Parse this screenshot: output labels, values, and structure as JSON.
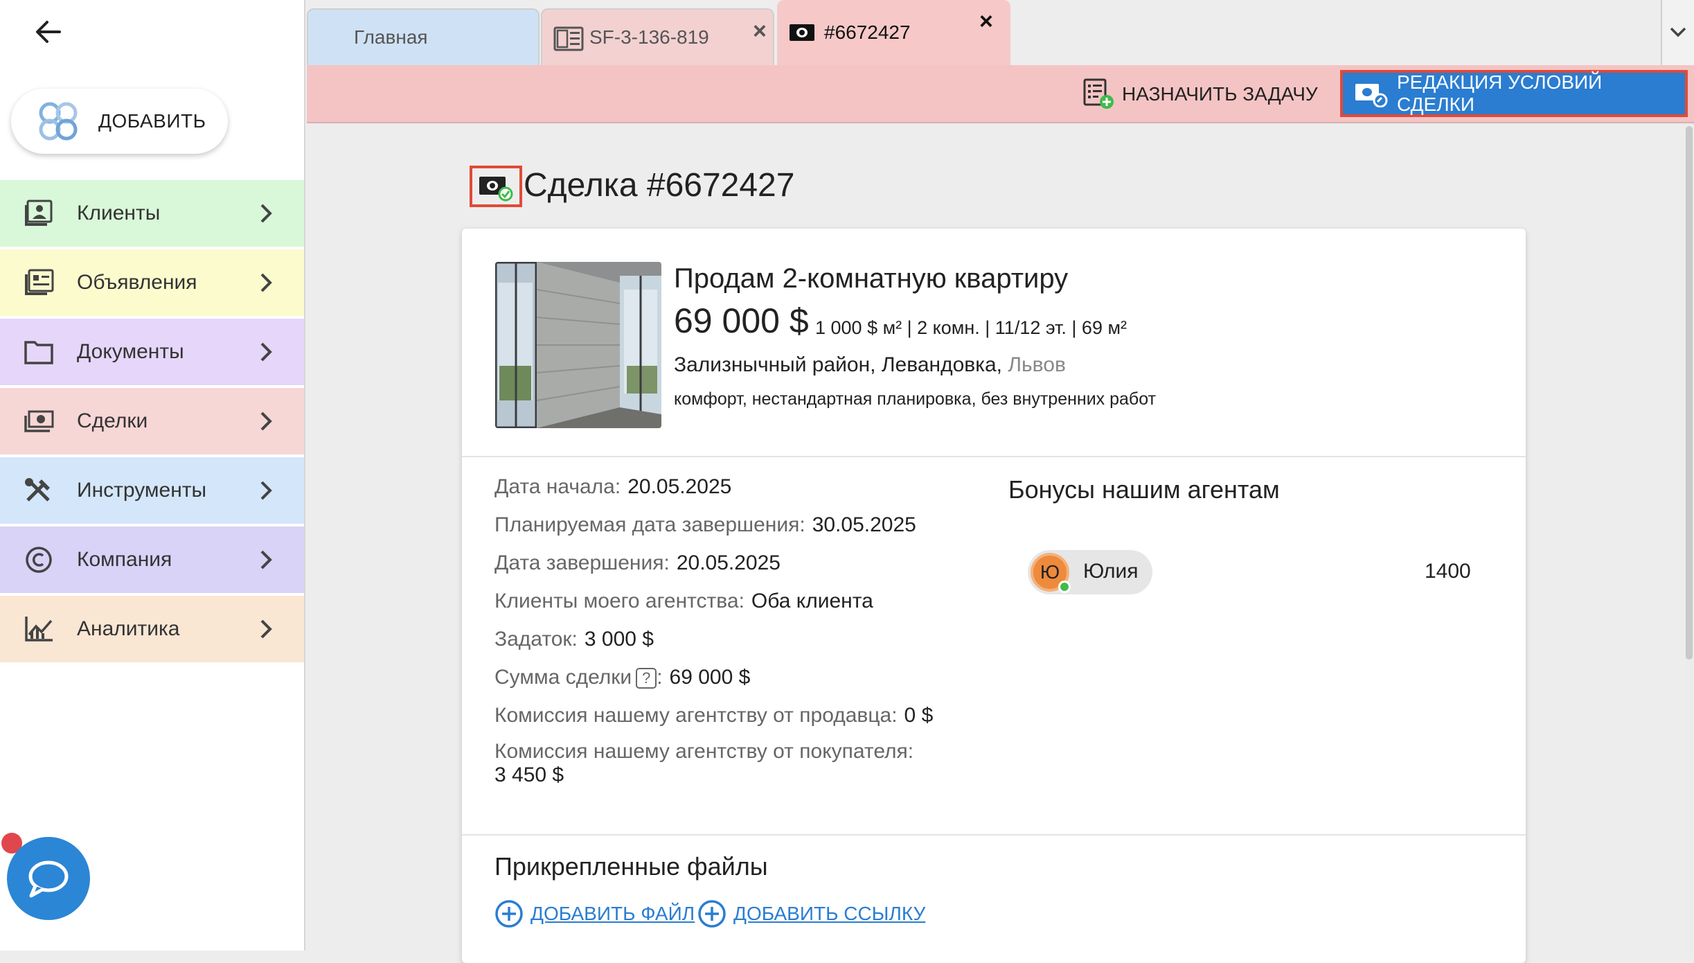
{
  "sidebar": {
    "add_label": "ДОБАВИТЬ",
    "items": [
      {
        "label": "Клиенты",
        "icon": "clients-icon",
        "color": "#d9f7d9"
      },
      {
        "label": "Объявления",
        "icon": "listings-icon",
        "color": "#fbfbce"
      },
      {
        "label": "Документы",
        "icon": "folder-icon",
        "color": "#e6d6fa"
      },
      {
        "label": "Сделки",
        "icon": "money-icon",
        "color": "#f7d6d6"
      },
      {
        "label": "Инструменты",
        "icon": "tools-icon",
        "color": "#d3e6fa"
      },
      {
        "label": "Компания",
        "icon": "copyright-icon",
        "color": "#d8d3f7"
      },
      {
        "label": "Аналитика",
        "icon": "analytics-icon",
        "color": "#f9e6d3"
      }
    ]
  },
  "tabs": [
    {
      "label": "Главная",
      "color": "#cfe2f5"
    },
    {
      "label": "SF-3-136-819",
      "color": "#f3d1d1"
    },
    {
      "label": "#6672427",
      "color": "#f6c8c8"
    }
  ],
  "toolbar": {
    "assign_task": "НАЗНАЧИТЬ ЗАДАЧУ",
    "edit_deal_terms": "РЕДАКЦИЯ УСЛОВИЙ СДЕЛКИ",
    "accent": "#2a7dd1",
    "highlight": "#e04a38"
  },
  "page": {
    "title": "Сделка #6672427"
  },
  "listing": {
    "title": "Продам 2-комнатную квартиру",
    "price": "69 000 $",
    "params": "1 000 $ м² | 2 комн. | 11/12 эт. | 69 м²",
    "address": "Зализнычный район, Левандовка,",
    "city": "Львов",
    "description": "комфорт, нестандартная планировка, без внутренних работ"
  },
  "deal": {
    "start_date": {
      "label": "Дата начала:",
      "value": "20.05.2025"
    },
    "planned_end": {
      "label": "Планируемая дата завершения:",
      "value": "30.05.2025"
    },
    "end_date": {
      "label": "Дата завершения:",
      "value": "20.05.2025"
    },
    "clients": {
      "label": "Клиенты моего агентства:",
      "value": "Оба клиента"
    },
    "deposit": {
      "label": "Задаток:",
      "value": "3 000 $"
    },
    "sum": {
      "label": "Сумма сделки",
      "help": "?",
      "colon": ":",
      "value": "69 000 $"
    },
    "seller_commission": {
      "label": "Комиссия нашему агентству от продавца:",
      "value": "0 $"
    },
    "buyer_commission": {
      "label": "Комиссия нашему агентству от покупателя:",
      "value": "3 450 $"
    }
  },
  "bonuses": {
    "title": "Бонусы нашим агентам",
    "agents": [
      {
        "initial": "Ю",
        "name": "Юлия",
        "amount": "1400"
      }
    ]
  },
  "files": {
    "title": "Прикрепленные файлы",
    "add_file": "ДОБАВИТЬ ФАЙЛ",
    "add_link": "ДОБАВИТЬ ССЫЛКУ"
  }
}
